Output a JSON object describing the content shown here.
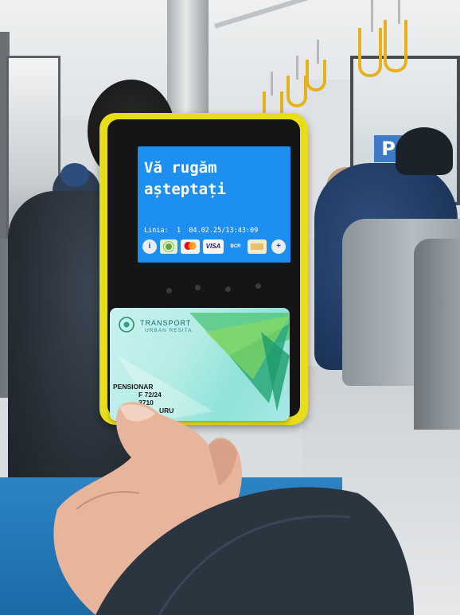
{
  "validator": {
    "screen": {
      "message": "Vă rugăm\nașteptați",
      "status": "Linia:  1  04.02.25/13:43:09"
    },
    "payment_options": [
      {
        "label": "i",
        "icon": "info-icon"
      },
      {
        "label": "",
        "icon": "contactless-pay-icon"
      },
      {
        "label": "",
        "icon": "mastercard-logo"
      },
      {
        "label": "VISA",
        "icon": "visa-logo"
      },
      {
        "label": "BCR",
        "icon": "bcr-logo"
      },
      {
        "label": "",
        "icon": "card-icon"
      },
      {
        "label": "+",
        "icon": "plus-icon"
      }
    ]
  },
  "card": {
    "brand": "TRANSPORT",
    "brand_sub": "URBAN RESITA",
    "type": "PENSIONAR",
    "line1": "F      72/24",
    "line2": "     3710",
    "line3": "URU"
  },
  "colors": {
    "validator_yellow": "#e7dd1b",
    "screen_blue": "#1d8ff0",
    "card_teal": "#8fe3d8",
    "seat_blue": "#2c84c4"
  },
  "sign": "P"
}
